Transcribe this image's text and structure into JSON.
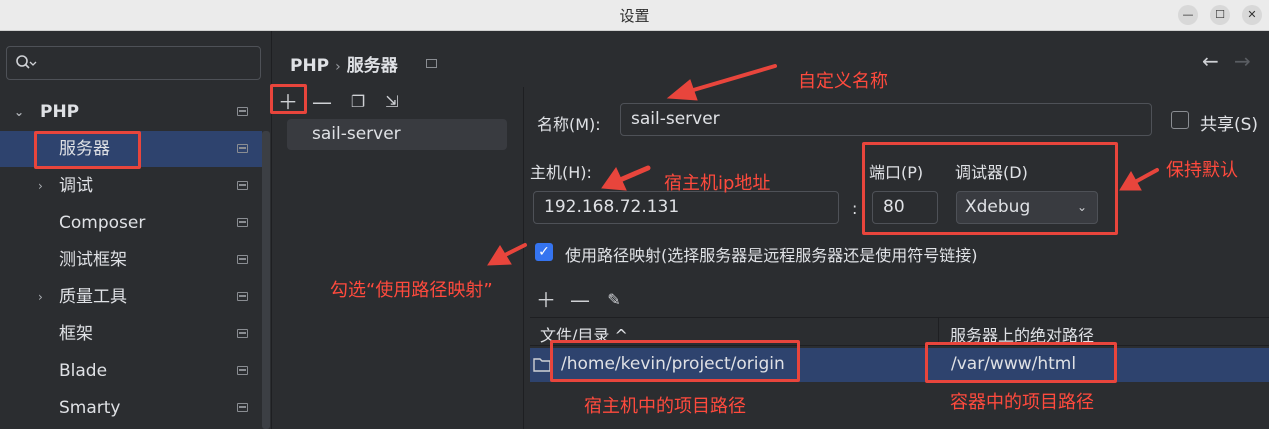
{
  "window": {
    "title": "设置"
  },
  "sidebar": {
    "search_placeholder": "",
    "items": [
      {
        "label": "PHP",
        "expanded": true
      },
      {
        "label": "服务器"
      },
      {
        "label": "调试"
      },
      {
        "label": "Composer"
      },
      {
        "label": "测试框架"
      },
      {
        "label": "质量工具"
      },
      {
        "label": "框架"
      },
      {
        "label": "Blade"
      },
      {
        "label": "Smarty"
      }
    ]
  },
  "breadcrumb": {
    "root": "PHP",
    "separator": "›",
    "current": "服务器"
  },
  "server_list": {
    "items": [
      "sail-server"
    ]
  },
  "form": {
    "name_label": "名称(M):",
    "name_value": "sail-server",
    "share_label": "共享(S)",
    "host_label": "主机(H):",
    "host_value": "192.168.72.131",
    "port_label": "端口(P)",
    "port_value": "80",
    "colon": ":",
    "debugger_label": "调试器(D)",
    "debugger_value": "Xdebug",
    "path_mapping_label": "使用路径映射(选择服务器是远程服务器还是使用符号链接)",
    "path_mapping_checked": true
  },
  "mapping_table": {
    "col_local": "文件/目录 ^",
    "col_remote": "服务器上的绝对路径",
    "rows": [
      {
        "local": "/home/kevin/project/origin",
        "remote": "/var/www/html"
      }
    ]
  },
  "annotations": {
    "custom_name": "自定义名称",
    "host_ip": "宿主机ip地址",
    "keep_default": "保持默认",
    "check_mapping": "勾选“使用路径映射”",
    "host_project_path": "宿主机中的项目路径",
    "container_project_path": "容器中的项目路径"
  },
  "colors": {
    "accent": "#3574f0",
    "selection": "#2e436e",
    "annotation": "#e8453c"
  }
}
